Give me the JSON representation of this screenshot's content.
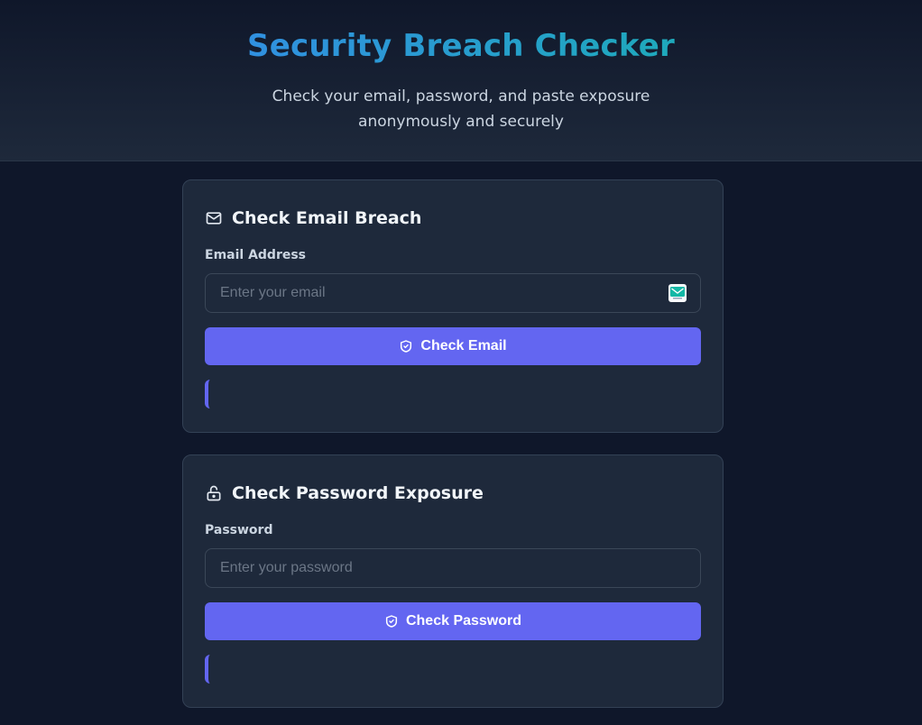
{
  "header": {
    "title": "Security Breach Checker",
    "subtitle": "Check your email, password, and paste exposure anonymously and securely"
  },
  "email_card": {
    "title": "Check Email Breach",
    "icon": "envelope-icon",
    "field_label": "Email Address",
    "field_placeholder": "Enter your email",
    "field_value": "",
    "button_label": "Check Email",
    "button_icon": "shield-check-icon"
  },
  "password_card": {
    "title": "Check Password Exposure",
    "icon": "lock-icon",
    "field_label": "Password",
    "field_placeholder": "Enter your password",
    "field_value": "",
    "button_label": "Check Password",
    "button_icon": "shield-check-icon"
  },
  "colors": {
    "background": "#0f172a",
    "card": "#1e293b",
    "accent": "#6366f1",
    "title_gradient_start": "#3b82f6",
    "title_gradient_end": "#14b8a6"
  }
}
